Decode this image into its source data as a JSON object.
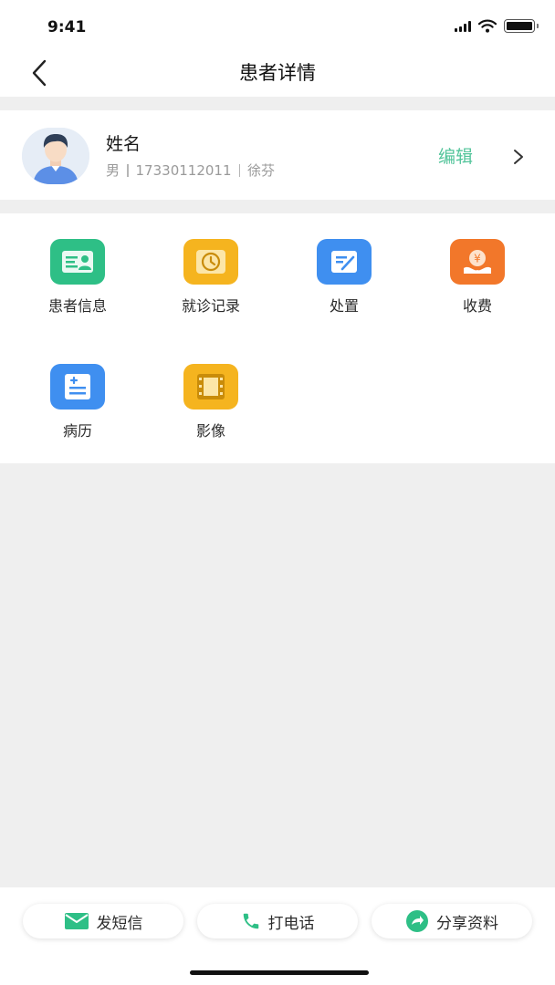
{
  "status_bar": {
    "time": "9:41"
  },
  "header": {
    "title": "患者详情"
  },
  "patient": {
    "name": "姓名",
    "gender": "男",
    "phone": "17330112011",
    "doctor": "徐芬",
    "edit_label": "编辑"
  },
  "menu": {
    "items": [
      {
        "label": "患者信息",
        "icon": "id-card-icon",
        "color": "#2ebf86"
      },
      {
        "label": "就诊记录",
        "icon": "clock-icon",
        "color": "#f5b41f"
      },
      {
        "label": "处置",
        "icon": "edit-note-icon",
        "color": "#3f8ff0"
      },
      {
        "label": "收费",
        "icon": "yuan-payment-icon",
        "color": "#f2772a"
      },
      {
        "label": "病历",
        "icon": "medical-record-icon",
        "color": "#3f8ff0"
      },
      {
        "label": "影像",
        "icon": "film-icon",
        "color": "#f5b41f"
      }
    ]
  },
  "footer": {
    "sms_label": "发短信",
    "call_label": "打电话",
    "share_label": "分享资料"
  },
  "colors": {
    "accent_green": "#52c49a",
    "background": "#efefef"
  }
}
